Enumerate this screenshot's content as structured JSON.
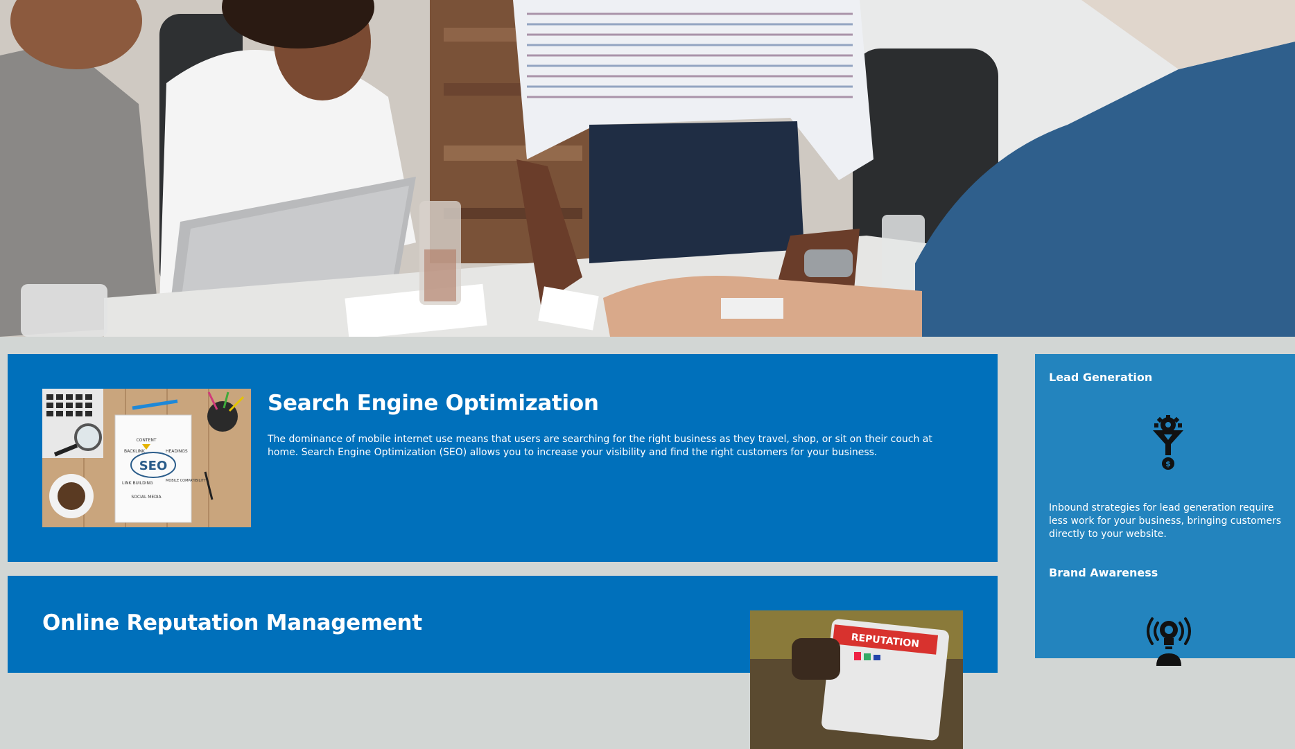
{
  "hero": {
    "image": "meeting-photo"
  },
  "main": {
    "seo": {
      "title": "Search Engine Optimization",
      "text": "The dominance of mobile internet use means that users are searching for the right business as they travel, shop, or sit on their couch at home. Search Engine Optimization (SEO) allows you to increase your visibility and find the right customers for your business.",
      "image_labels": {
        "center": "SEO",
        "content": "CONTENT",
        "backlink": "BACKLINK",
        "headings": "HEADINGS",
        "link_building": "LINK BUILDING",
        "mobile": "MOBILE COMPATIBILITY",
        "social": "SOCIAL MEDIA"
      }
    },
    "orm": {
      "title": "Online Reputation Management",
      "text": "",
      "image_label": "REPUTATION"
    }
  },
  "sidebar": {
    "lead": {
      "title": "Lead Generation",
      "icon": "funnel-gear-icon",
      "text": "Inbound strategies for lead generation require less work for your business, bringing customers directly to your website."
    },
    "brand": {
      "title": "Brand Awareness",
      "icon": "lightbulb-broadcast-icon"
    }
  },
  "colors": {
    "page_bg": "#d2d6d4",
    "card_blue": "#0070bb",
    "sidebar_blue": "#2384be",
    "text": "#ffffff"
  }
}
